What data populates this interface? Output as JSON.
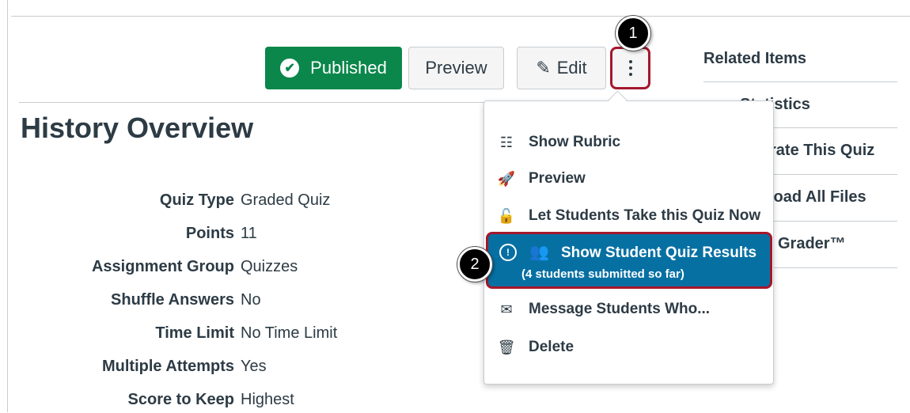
{
  "toolbar": {
    "published_label": "Published",
    "preview_label": "Preview",
    "edit_label": "Edit"
  },
  "callouts": [
    "1",
    "2"
  ],
  "page_title": "History Overview",
  "details": [
    {
      "label": "Quiz Type",
      "value": "Graded Quiz"
    },
    {
      "label": "Points",
      "value": "11"
    },
    {
      "label": "Assignment Group",
      "value": "Quizzes"
    },
    {
      "label": "Shuffle Answers",
      "value": "No"
    },
    {
      "label": "Time Limit",
      "value": "No Time Limit"
    },
    {
      "label": "Multiple Attempts",
      "value": "Yes"
    },
    {
      "label": "Score to Keep",
      "value": "Highest"
    }
  ],
  "related": {
    "title": "Related Items",
    "items": [
      "Quiz Statistics",
      "Moderate This Quiz",
      "Download All Files",
      "SpeedGrader™"
    ],
    "visible": [
      "Statistics",
      "rate This Quiz",
      "load All Files",
      "Grader™"
    ]
  },
  "menu": {
    "items": [
      {
        "label": "Show Rubric",
        "icon": "rubric-icon"
      },
      {
        "label": "Preview",
        "icon": "rocket-icon"
      },
      {
        "label": "Let Students Take this Quiz Now",
        "icon": "unlock-icon"
      },
      {
        "label": "Message Students Who...",
        "icon": "envelope-icon"
      },
      {
        "label": "Delete",
        "icon": "trash-icon"
      }
    ],
    "highlighted": {
      "label": "Show Student Quiz Results",
      "sublabel": "(4 students submitted so far)"
    }
  },
  "colors": {
    "published_green": "#0b874b",
    "highlight_blue": "#0770a3",
    "callout_border_red": "#a4182b"
  }
}
